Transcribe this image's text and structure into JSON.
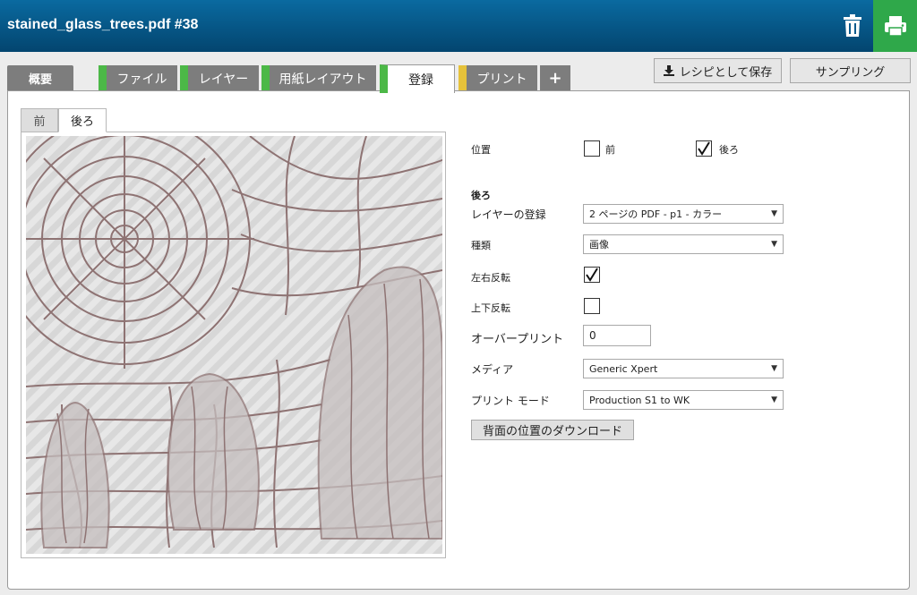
{
  "header": {
    "title": "stained_glass_trees.pdf #38",
    "trash_icon": "trash-icon",
    "print_icon": "printer-icon",
    "print_color": "#2fa84a"
  },
  "tabs": [
    {
      "label": "概要"
    },
    {
      "label": "ファイル"
    },
    {
      "label": "レイヤー"
    },
    {
      "label": "用紙レイアウト"
    },
    {
      "label": "登録"
    },
    {
      "label": "プリント"
    },
    {
      "label": "+"
    }
  ],
  "toolbar": {
    "save_recipe_label": "レシピとして保存",
    "save_recipe_icon": "download-icon",
    "sampling_label": "サンプリング"
  },
  "side_tabs": {
    "front": "前",
    "back": "後ろ"
  },
  "settings": {
    "position_label": "位置",
    "position_front_label": "前",
    "position_front_checked": false,
    "position_back_label": "後ろ",
    "position_back_checked": true,
    "section_title": "後ろ",
    "layer_reg_label": "レイヤーの登録",
    "layer_reg_value": "2 ページの PDF - p1 - カラー",
    "type_label": "種類",
    "type_value": "画像",
    "flip_h_label": "左右反転",
    "flip_h_checked": true,
    "flip_v_label": "上下反転",
    "flip_v_checked": false,
    "overprint_label": "オーバープリント",
    "overprint_value": "0",
    "media_label": "メディア",
    "media_value": "Generic Xpert",
    "print_mode_label": "プリント モード",
    "print_mode_value": "Production S1 to WK",
    "download_button": "背面の位置のダウンロード"
  }
}
